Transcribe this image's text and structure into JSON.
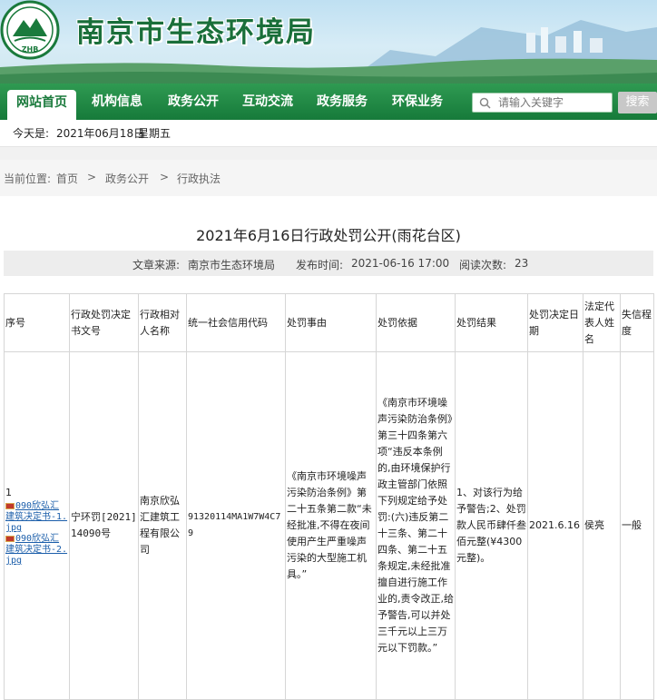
{
  "header": {
    "site_title": "南京市生态环境局",
    "logo_text": "ZHB"
  },
  "nav": {
    "items": [
      "网站首页",
      "机构信息",
      "政务公开",
      "互动交流",
      "政务服务",
      "环保业务"
    ],
    "search_placeholder": "请输入关键字",
    "search_button": "搜索"
  },
  "datebar": {
    "label": "今天是:",
    "date": "2021年06月18日",
    "weekday": "星期五"
  },
  "breadcrumb": {
    "prefix": "当前位置:",
    "items": [
      "首页",
      "政务公开",
      "行政执法"
    ],
    "separator": ">"
  },
  "article": {
    "title": "2021年6月16日行政处罚公开(雨花台区)",
    "source_label": "文章来源:",
    "source": "南京市生态环境局",
    "time_label": "发布时间:",
    "time": "2021-06-16 17:00",
    "reads_label": "阅读次数:",
    "reads": "23"
  },
  "table": {
    "headers": [
      "序号",
      "行政处罚决定书文号",
      "行政相对人名称",
      "统一社会信用代码",
      "处罚事由",
      "处罚依据",
      "处罚结果",
      "处罚决定日期",
      "法定代表人姓名",
      "失信程度"
    ],
    "row": {
      "index": "1",
      "attachments": [
        "090欣弘汇建筑决定书-1.jpg",
        "090欣弘汇建筑决定书-2.jpg"
      ],
      "doc_no": "宁环罚[2021]14090号",
      "party": "南京欣弘汇建筑工程有限公司",
      "credit_code": "91320114MA1W7W4C79",
      "reason": "《南京市环境噪声污染防治条例》第二十五条第二款“未经批准,不得在夜间使用产生严重噪声污染的大型施工机具。”",
      "basis": "《南京市环境噪声污染防治条例》第三十四条第六项“违反本条例的,由环境保护行政主管部门依照下列规定给予处罚:(六)违反第二十三条、第二十四条、第二十五条规定,未经批准擅自进行施工作业的,责令改正,给予警告,可以并处三千元以上三万元以下罚款。”",
      "result": "1、对该行为给予警告;2、处罚款人民币肆仟叁佰元整(¥4300元整)。",
      "date": "2021.6.16",
      "legal_rep": "侯亮",
      "credit_level": "一般"
    }
  },
  "colors": {
    "nav_green": "#167a3a",
    "title_green": "#1a6f3a",
    "link_blue": "#1b5eaa"
  }
}
